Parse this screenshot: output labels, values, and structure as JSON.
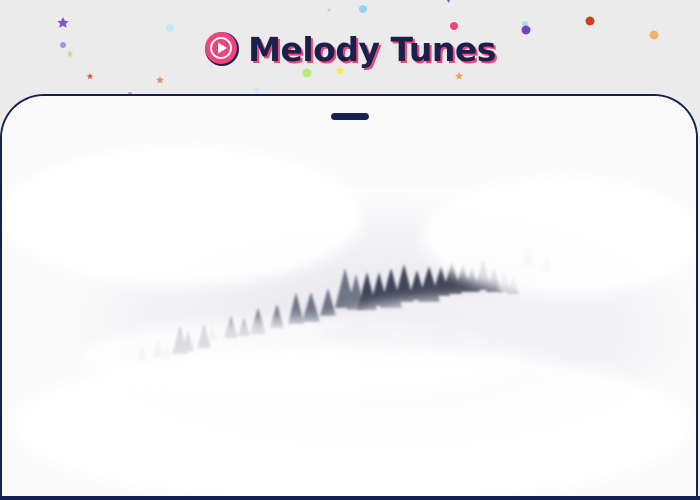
{
  "brand": {
    "name": "Melody Tunes",
    "icon": "play-circle-icon",
    "icon_color": "#f0457a",
    "text_color": "#1a1f4c"
  },
  "frame": {
    "border_color": "#14204f",
    "background": "#ebebeb"
  },
  "hero_image": {
    "subject": "misty-forest-photo"
  }
}
